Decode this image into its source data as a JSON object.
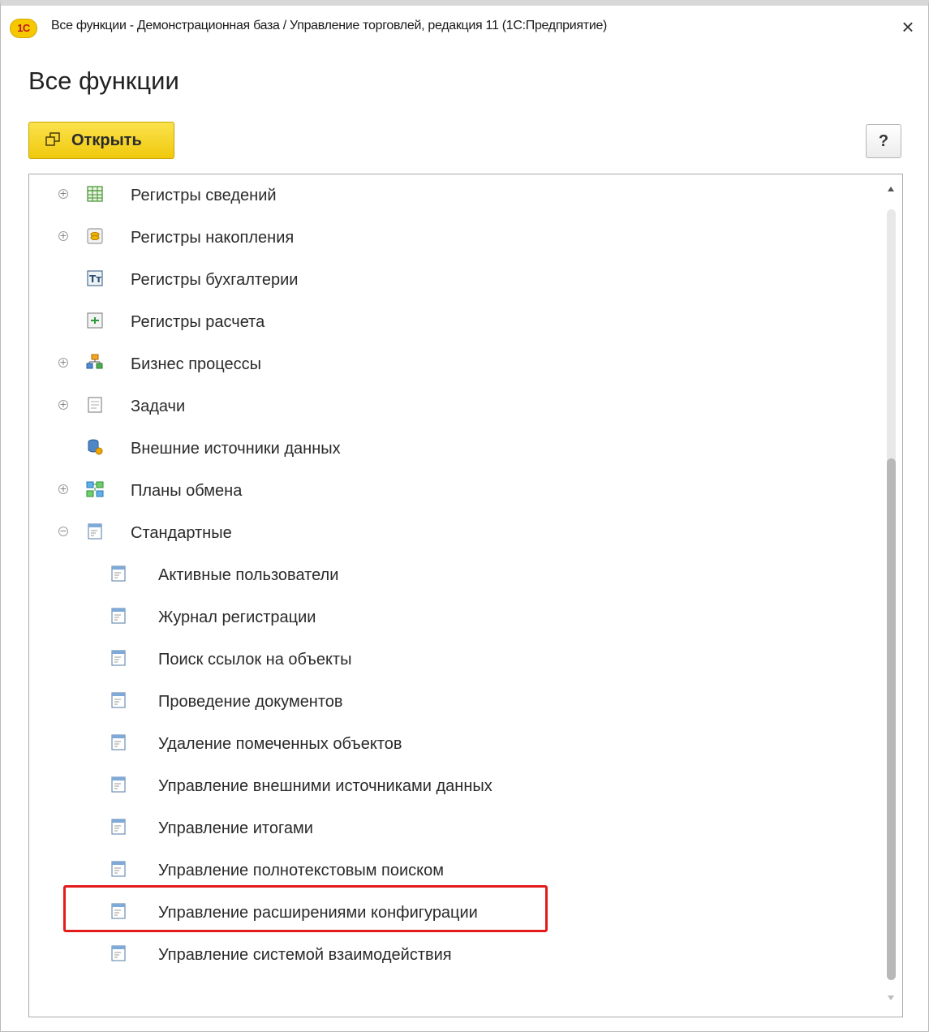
{
  "window": {
    "title": "Все функции - Демонстрационная база / Управление торговлей, редакция 11  (1С:Предприятие)",
    "logo_text": "1С",
    "close_glyph": "×"
  },
  "page": {
    "title": "Все функции"
  },
  "toolbar": {
    "open_label": "Открыть",
    "open_icon": "open-window-icon",
    "help_label": "?"
  },
  "tree": {
    "items": [
      {
        "label": "Регистры сведений",
        "icon": "info-register-icon",
        "expander": "plus"
      },
      {
        "label": "Регистры накопления",
        "icon": "accumulation-register-icon",
        "expander": "plus"
      },
      {
        "label": "Регистры бухгалтерии",
        "icon": "accounting-register-icon",
        "expander": ""
      },
      {
        "label": "Регистры расчета",
        "icon": "calculation-register-icon",
        "expander": ""
      },
      {
        "label": "Бизнес процессы",
        "icon": "business-process-icon",
        "expander": "plus"
      },
      {
        "label": "Задачи",
        "icon": "task-icon",
        "expander": "plus"
      },
      {
        "label": "Внешние источники данных",
        "icon": "external-data-source-icon",
        "expander": ""
      },
      {
        "label": "Планы обмена",
        "icon": "exchange-plan-icon",
        "expander": "plus"
      },
      {
        "label": "Стандартные",
        "icon": "standard-processing-icon",
        "expander": "minus"
      }
    ],
    "standard_children": [
      {
        "label": "Активные пользователи",
        "icon": "form-icon"
      },
      {
        "label": "Журнал регистрации",
        "icon": "form-icon"
      },
      {
        "label": "Поиск ссылок на объекты",
        "icon": "form-icon"
      },
      {
        "label": "Проведение документов",
        "icon": "form-icon"
      },
      {
        "label": "Удаление помеченных объектов",
        "icon": "form-icon"
      },
      {
        "label": "Управление внешними источниками данных",
        "icon": "form-icon"
      },
      {
        "label": "Управление итогами",
        "icon": "form-icon"
      },
      {
        "label": "Управление полнотекстовым поиском",
        "icon": "form-icon"
      },
      {
        "label": "Управление расширениями конфигурации",
        "icon": "form-icon",
        "highlighted": true
      },
      {
        "label": "Управление системой взаимодействия",
        "icon": "form-icon"
      }
    ]
  },
  "colors": {
    "accent_button": "#f5d22b",
    "highlight": "#e31b1b"
  }
}
